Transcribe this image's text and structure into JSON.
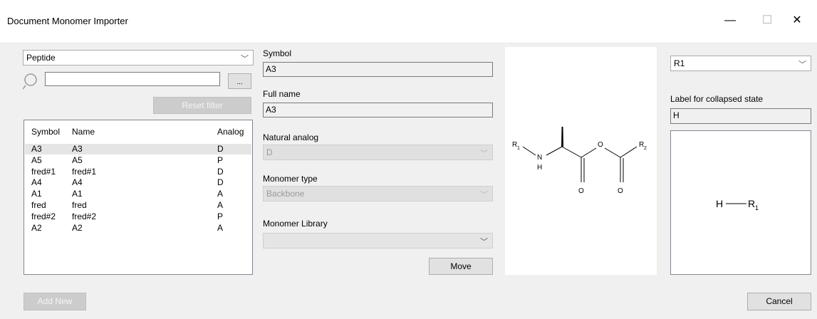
{
  "window": {
    "title": "Document Monomer Importer",
    "minimize_glyph": "—",
    "maximize_glyph": "☐",
    "close_glyph": "✕"
  },
  "left": {
    "type_select": {
      "value": "Peptide"
    },
    "search": {
      "value": "",
      "placeholder": "",
      "browse_label": "..."
    },
    "reset_filter_label": "Reset filter",
    "columns": [
      "Symbol",
      "Name",
      "Analog"
    ],
    "rows": [
      {
        "symbol": "A3",
        "name": "A3",
        "analog": "D",
        "selected": true
      },
      {
        "symbol": "A5",
        "name": "A5",
        "analog": "P"
      },
      {
        "symbol": "fred#1",
        "name": "fred#1",
        "analog": "D"
      },
      {
        "symbol": "A4",
        "name": "A4",
        "analog": "D"
      },
      {
        "symbol": "A1",
        "name": "A1",
        "analog": "A"
      },
      {
        "symbol": "fred",
        "name": "fred",
        "analog": "A"
      },
      {
        "symbol": "fred#2",
        "name": "fred#2",
        "analog": "P"
      },
      {
        "symbol": "A2",
        "name": "A2",
        "analog": "A"
      }
    ],
    "add_new_label": "Add New"
  },
  "middle": {
    "symbol_label": "Symbol",
    "symbol_value": "A3",
    "fullname_label": "Full name",
    "fullname_value": "A3",
    "natural_analog_label": "Natural analog",
    "natural_analog_value": "D",
    "monomer_type_label": "Monomer type",
    "monomer_type_value": "Backbone",
    "library_label": "Monomer Library",
    "library_value": "",
    "move_label": "Move"
  },
  "structure": {
    "r1": "R",
    "r1_sub": "1",
    "r2": "R",
    "r2_sub": "2",
    "n": "N",
    "h": "H",
    "o1": "O",
    "o2": "O",
    "o3": "O"
  },
  "right": {
    "rgroup_select": "R1",
    "collapsed_label": "Label for collapsed state",
    "collapsed_value": "H",
    "preview_h": "H",
    "preview_r": "R",
    "preview_sub": "1"
  },
  "footer": {
    "cancel_label": "Cancel"
  }
}
